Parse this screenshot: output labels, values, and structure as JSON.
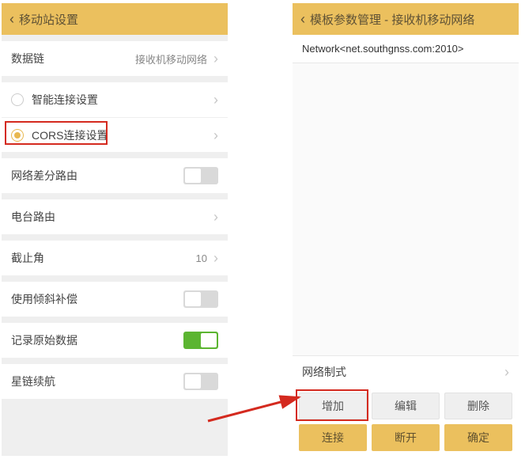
{
  "left": {
    "title": "移动站设置",
    "rows": {
      "datalink": {
        "label": "数据链",
        "value": "接收机移动网络"
      },
      "smart": {
        "label": "智能连接设置"
      },
      "cors": {
        "label": "CORS连接设置"
      },
      "diffroute": {
        "label": "网络差分路由"
      },
      "radio": {
        "label": "电台路由"
      },
      "cutoff": {
        "label": "截止角",
        "value": "10"
      },
      "tilt": {
        "label": "使用倾斜补偿"
      },
      "record": {
        "label": "记录原始数据"
      },
      "starlink": {
        "label": "星链续航"
      }
    }
  },
  "right": {
    "title": "模板参数管理 - 接收机移动网络",
    "network_entry": "Network<net.southgnss.com:2010>",
    "mode_label": "网络制式",
    "buttons": {
      "add": "增加",
      "edit": "编辑",
      "delete": "删除",
      "connect": "连接",
      "disconnect": "断开",
      "ok": "确定"
    }
  }
}
